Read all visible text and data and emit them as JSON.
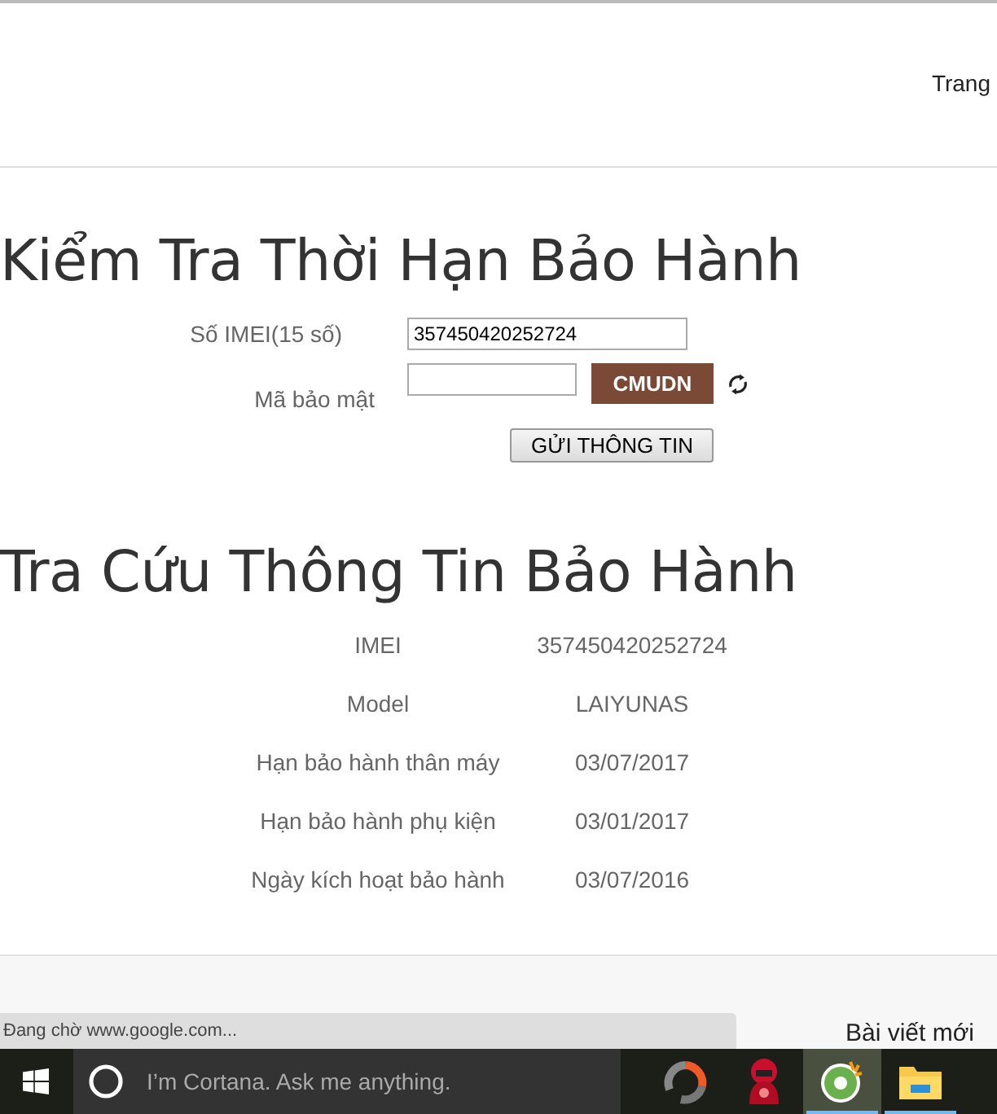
{
  "header": {
    "nav_link": "Trang"
  },
  "check_form": {
    "title": "Kiểm Tra Thời Hạn Bảo Hành",
    "imei_label": "Số IMEI(15 số)",
    "imei_value": "357450420252724",
    "captcha_label": "Mã bảo mật",
    "captcha_code": "CMUDN",
    "submit": "GỬI THÔNG TIN"
  },
  "result": {
    "title": "Tra Cứu Thông Tin Bảo Hành",
    "rows": [
      {
        "label": "IMEI",
        "value": "357450420252724"
      },
      {
        "label": "Model",
        "value": "LAIYUNAS"
      },
      {
        "label": "Hạn bảo hành thân máy",
        "value": "03/07/2017"
      },
      {
        "label": "Hạn bảo hành phụ kiện",
        "value": "03/01/2017"
      },
      {
        "label": "Ngày kích hoạt bảo hành",
        "value": "03/07/2016"
      }
    ]
  },
  "sidebar_heading": "Bài viết mới",
  "status_bar": "Đang chờ www.google.com...",
  "taskbar": {
    "search_placeholder": "I’m Cortana. Ask me anything.",
    "apps": [
      {
        "kind": "gauge",
        "running": false,
        "selected": false
      },
      {
        "kind": "mascot",
        "running": false,
        "selected": false
      },
      {
        "kind": "browser",
        "running": true,
        "selected": true
      },
      {
        "kind": "folder",
        "running": true,
        "selected": false
      }
    ]
  }
}
